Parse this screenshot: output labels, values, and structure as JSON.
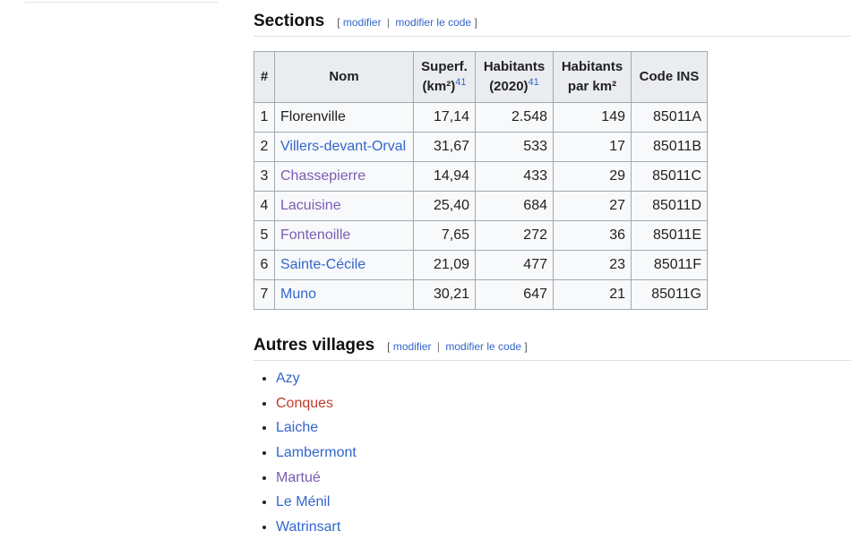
{
  "sections": {
    "title": "Sections",
    "edit": {
      "open": "[",
      "modifier": "modifier",
      "sep": "|",
      "modifier_code": "modifier le code",
      "close": "]"
    },
    "table": {
      "headers": {
        "idx": "#",
        "nom": "Nom",
        "superf_1": "Superf.",
        "superf_2": "(km²)",
        "superf_ref": "41",
        "hab_1": "Habitants",
        "hab_2": "(2020)",
        "hab_ref": "41",
        "dens_1": "Habitants",
        "dens_2": "par km²",
        "ins": "Code INS"
      },
      "rows": [
        {
          "idx": "1",
          "nom": "Florenville",
          "superf": "17,14",
          "hab": "2.548",
          "dens": "149",
          "ins": "85011A",
          "link": "none"
        },
        {
          "idx": "2",
          "nom": "Villers-devant-Orval",
          "superf": "31,67",
          "hab": "533",
          "dens": "17",
          "ins": "85011B",
          "link": "link"
        },
        {
          "idx": "3",
          "nom": "Chassepierre",
          "superf": "14,94",
          "hab": "433",
          "dens": "29",
          "ins": "85011C",
          "link": "visited"
        },
        {
          "idx": "4",
          "nom": "Lacuisine",
          "superf": "25,40",
          "hab": "684",
          "dens": "27",
          "ins": "85011D",
          "link": "visited"
        },
        {
          "idx": "5",
          "nom": "Fontenoille",
          "superf": "7,65",
          "hab": "272",
          "dens": "36",
          "ins": "85011E",
          "link": "visited"
        },
        {
          "idx": "6",
          "nom": "Sainte-Cécile",
          "superf": "21,09",
          "hab": "477",
          "dens": "23",
          "ins": "85011F",
          "link": "link"
        },
        {
          "idx": "7",
          "nom": "Muno",
          "superf": "30,21",
          "hab": "647",
          "dens": "21",
          "ins": "85011G",
          "link": "link"
        }
      ]
    }
  },
  "villages": {
    "title": "Autres villages",
    "edit": {
      "open": "[",
      "modifier": "modifier",
      "sep": "|",
      "modifier_code": "modifier le code",
      "close": "]"
    },
    "items": [
      {
        "label": "Azy",
        "link": "link"
      },
      {
        "label": "Conques",
        "link": "new"
      },
      {
        "label": "Laiche",
        "link": "link"
      },
      {
        "label": "Lambermont",
        "link": "link"
      },
      {
        "label": "Martué",
        "link": "visited"
      },
      {
        "label": "Le Ménil",
        "link": "link"
      },
      {
        "label": "Watrinsart",
        "link": "link"
      }
    ]
  },
  "colors": {
    "link": "#3366cc",
    "visited": "#795cb2",
    "new": "#bf3c2c"
  }
}
